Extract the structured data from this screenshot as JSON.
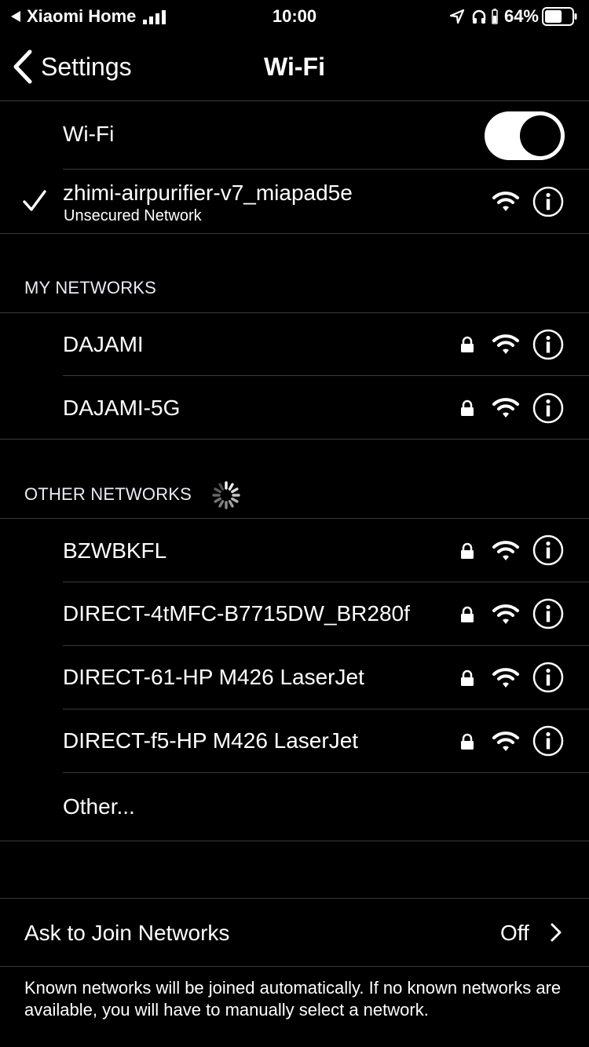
{
  "status_bar": {
    "carrier": "Xiaomi Home",
    "time": "10:00",
    "battery_percent": "64%",
    "battery_level": 0.64
  },
  "nav": {
    "back_label": "Settings",
    "title": "Wi-Fi"
  },
  "wifi_toggle": {
    "label": "Wi-Fi",
    "on": true
  },
  "connected": {
    "name": "zhimi-airpurifier-v7_miapad5e",
    "subtitle": "Unsecured Network"
  },
  "my_networks": {
    "header": "MY NETWORKS",
    "items": [
      {
        "name": "DAJAMI"
      },
      {
        "name": "DAJAMI-5G"
      }
    ]
  },
  "other_networks": {
    "header": "OTHER NETWORKS",
    "items": [
      {
        "name": "BZWBKFL"
      },
      {
        "name": "DIRECT-4tMFC-B7715DW_BR280f"
      },
      {
        "name": "DIRECT-61-HP M426 LaserJet"
      },
      {
        "name": "DIRECT-f5-HP M426 LaserJet"
      }
    ],
    "other_label": "Other..."
  },
  "ask_to_join": {
    "label": "Ask to Join Networks",
    "value": "Off",
    "footer": "Known networks will be joined automatically. If no known networks are available, you will have to manually select a network."
  },
  "colors": {
    "background": "#000000",
    "separator": "#3a3a3c",
    "text": "#ffffff"
  }
}
